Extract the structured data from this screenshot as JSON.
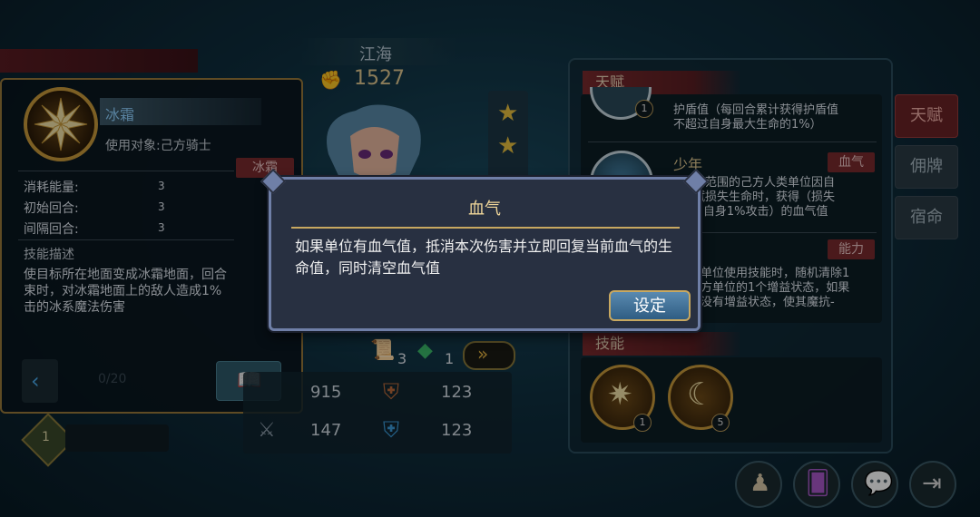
{
  "hero": {
    "name": "江海",
    "power": "1527"
  },
  "skill_panel": {
    "skill_name": "冰霜",
    "target": "使用对象:己方骑士",
    "element_tag": "冰霜",
    "rows": [
      {
        "label": "消耗能量:",
        "value": "3"
      },
      {
        "label": "初始回合:",
        "value": "3"
      },
      {
        "label": "间隔回合:",
        "value": "3"
      }
    ],
    "desc_title": "技能描述",
    "desc_lines": [
      "使目标所在地面变成冰霜地面，回合",
      "束时，对冰霜地面上的敌人造成1%",
      "击的冰系魔法伤害"
    ],
    "page": "0/20",
    "level_badge": "1"
  },
  "items": {
    "count_a": "3",
    "count_b": "1"
  },
  "stats": {
    "a": "915",
    "b": "123",
    "c": "147",
    "d": "123"
  },
  "talent_panel": {
    "header": "天赋",
    "entries": [
      {
        "text_lines": [
          "护盾值（每回合累计获得护盾值",
          "不超过自身最大生命的1%）"
        ],
        "badge": "1"
      },
      {
        "name": "少年",
        "tag": "血气",
        "text_lines": [
          "格范围的己方人类单位因自",
          "赋损失生命时，获得（损失",
          "+自身1%攻击）的血气值"
        ]
      },
      {
        "name": "",
        "tag": "能力",
        "text_lines": [
          "单位使用技能时，随机清除1",
          "方单位的1个增益状态，如果",
          "没有增益状态，使其魔抗-"
        ]
      }
    ],
    "skills_header": "技能",
    "skill_badges": [
      "1",
      "5"
    ]
  },
  "side_tabs": [
    "天赋",
    "佣牌",
    "宿命"
  ],
  "dialog": {
    "title": "血气",
    "body": "如果单位有血气值，抵消本次伤害并立即回复当前血气的生命值，同时清空血气值",
    "confirm": "设定"
  },
  "colors": {
    "gold": "#c8a860",
    "accent_red": "#7a2a2e",
    "dialog_bg": "#283041",
    "highlight_green": "#6cd36c"
  }
}
